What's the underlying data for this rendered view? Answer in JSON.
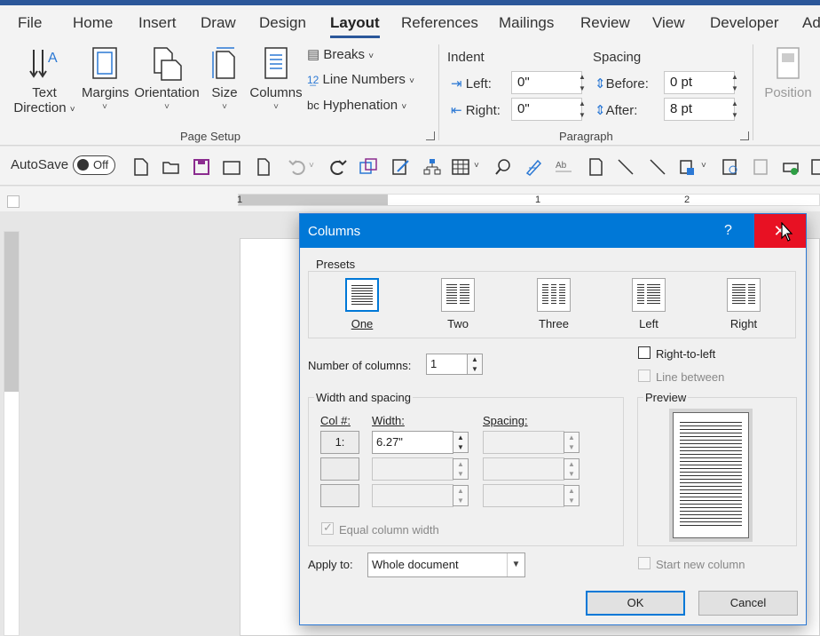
{
  "tabs": [
    "File",
    "Home",
    "Insert",
    "Draw",
    "Design",
    "Layout",
    "References",
    "Mailings",
    "Review",
    "View",
    "Developer",
    "Ad"
  ],
  "ribbon": {
    "text_direction": [
      "Text",
      "Direction"
    ],
    "margins": "Margins",
    "orientation": "Orientation",
    "size": "Size",
    "columns": "Columns",
    "breaks": "Breaks",
    "line_numbers": "Line Numbers",
    "hyphenation": "Hyphenation",
    "page_setup_label": "Page Setup",
    "indent_label": "Indent",
    "spacing_label": "Spacing",
    "left_label": "Left:",
    "left_value": "0\"",
    "right_label": "Right:",
    "right_value": "0\"",
    "before_label": "Before:",
    "before_value": "0 pt",
    "after_label": "After:",
    "after_value": "8 pt",
    "paragraph_label": "Paragraph",
    "position": "Position"
  },
  "qat": {
    "autosave": "AutoSave",
    "toggle": "Off"
  },
  "ruler": {
    "nums": [
      "1",
      "1",
      "2"
    ]
  },
  "dialog": {
    "title": "Columns",
    "help": "?",
    "close": "✕",
    "presets_label": "Presets",
    "presets": [
      "One",
      "Two",
      "Three",
      "Left",
      "Right"
    ],
    "rtl_label": "Right-to-left",
    "line_between_label": "Line between",
    "num_columns_label": "Number of columns:",
    "num_columns_value": "1",
    "width_spacing_label": "Width and spacing",
    "col_header": "Col #:",
    "width_header": "Width:",
    "spacing_header": "Spacing:",
    "row1_col": "1:",
    "row1_width": "6.27\"",
    "equal_width_label": "Equal column width",
    "preview_label": "Preview",
    "apply_to_label": "Apply to:",
    "apply_to_value": "Whole document",
    "start_new_column_label": "Start new column",
    "ok": "OK",
    "cancel": "Cancel"
  }
}
